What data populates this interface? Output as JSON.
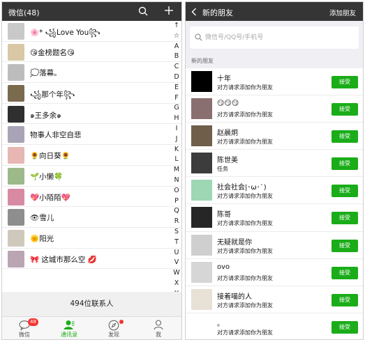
{
  "left": {
    "title": "微信(48)",
    "contacts": [
      {
        "name": "🌸* ꧁Love You꧂",
        "avatar": "#c9c9c9"
      },
      {
        "name": "😘金榜题名😘",
        "avatar": "#d9c8a6"
      },
      {
        "name": "💭落幕。",
        "avatar": "#bdbdbd"
      },
      {
        "name": "꧁那个年꧂",
        "avatar": "#7a6a4e"
      },
      {
        "name": "๑王多余๑",
        "avatar": "#2f2f2f"
      },
      {
        "name": "物事人非空自悲",
        "avatar": "#a9a4b5"
      },
      {
        "name": "🌻向日葵🌻",
        "avatar": "#e6b7b3"
      },
      {
        "name": "🌱小懒🍀",
        "avatar": "#9db98a"
      },
      {
        "name": "💖小陌陌💖",
        "avatar": "#d98aa3"
      },
      {
        "name": "👁雪儿",
        "avatar": "#8e8e8e"
      },
      {
        "name": "🌞阳光",
        "avatar": "#cfc9bd"
      },
      {
        "name": "🎀 这城市那么空 💋",
        "avatar": "#b9a6b2"
      },
      {
        "name": "494位联系人",
        "avatar": "#ffffff"
      }
    ],
    "index_letters": [
      "↑",
      "☆",
      "A",
      "B",
      "C",
      "D",
      "E",
      "F",
      "G",
      "H",
      "I",
      "J",
      "K",
      "L",
      "M",
      "N",
      "O",
      "P",
      "Q",
      "R",
      "S",
      "T",
      "U",
      "V",
      "W",
      "X",
      "Y",
      "Z",
      "#"
    ],
    "count": "494位联系人",
    "tabs": [
      {
        "label": "微信",
        "icon": "chat-icon",
        "badge": "48"
      },
      {
        "label": "通讯录",
        "icon": "contacts-icon",
        "active": true
      },
      {
        "label": "发现",
        "icon": "compass-icon",
        "dot": true
      },
      {
        "label": "我",
        "icon": "person-icon"
      }
    ]
  },
  "right": {
    "title": "新的朋友",
    "add_label": "添加朋友",
    "search_placeholder": "微信号/QQ号/手机号",
    "section_label": "新的朋友",
    "accept_label": "接受",
    "requests": [
      {
        "name": "十年",
        "message": "对方请求添加你为朋友",
        "avatar": "#000000"
      },
      {
        "name": "😏😏😏",
        "message": "对方请求添加你为朋友",
        "avatar": "#8a6f70"
      },
      {
        "name": "赵晨炯",
        "message": "对方请求添加你为朋友",
        "avatar": "#6e5e4a"
      },
      {
        "name": "陈世美",
        "message": "任务",
        "avatar": "#3c3c3c"
      },
      {
        "name": "社会社会|･ω･`)",
        "message": "对方请求添加你为朋友",
        "avatar": "#9ed7b4"
      },
      {
        "name": "陈哥",
        "message": "对方请求添加你为朋友",
        "avatar": "#262626"
      },
      {
        "name": "无疑就是你",
        "message": "对方请求添加你为朋友",
        "avatar": "#cfcfcf"
      },
      {
        "name": "ovo",
        "message": "对方请求添加你为朋友",
        "avatar": "#d6d6d6"
      },
      {
        "name": "接着喵的人",
        "message": "对方请求添加你为朋友",
        "avatar": "#e8e2d6"
      },
      {
        "name": "。",
        "message": "对方请求添加你为朋友",
        "avatar": "#ffffff"
      }
    ]
  },
  "colors": {
    "topbar": "#353535",
    "accent": "#1aad19",
    "badge": "#f43530"
  }
}
